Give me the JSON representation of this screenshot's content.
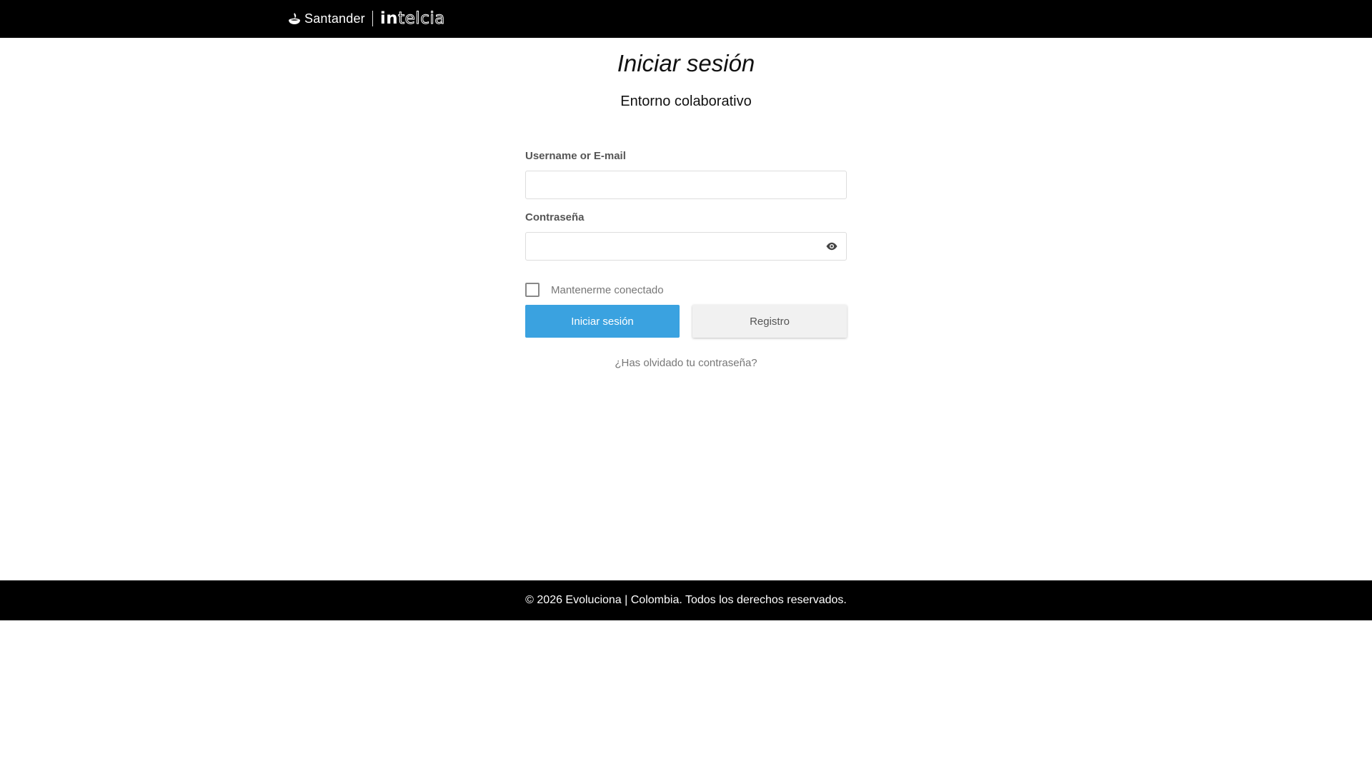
{
  "header": {
    "brand_primary": "Santander",
    "brand_secondary_bold": "in",
    "brand_secondary_thin": "telcia"
  },
  "page": {
    "title": "Iniciar sesión",
    "subtitle": "Entorno colaborativo"
  },
  "form": {
    "username_label": "Username or E-mail",
    "username_value": "",
    "password_label": "Contraseña",
    "password_value": "",
    "remember_label": "Mantenerme conectado",
    "remember_checked": false,
    "login_button": "Iniciar sesión",
    "register_button": "Registro",
    "forgot_link": "¿Has olvidado tu contraseña?"
  },
  "footer": {
    "text": "© 2026 Evoluciona | Colombia. Todos los derechos reservados."
  },
  "icons": {
    "logo": "santander-flame-icon",
    "password_toggle": "eye-icon"
  },
  "colors": {
    "topbar": "#000000",
    "primary_button": "#3aa2e0",
    "secondary_button": "#f1f1f1",
    "footer": "#000000"
  }
}
